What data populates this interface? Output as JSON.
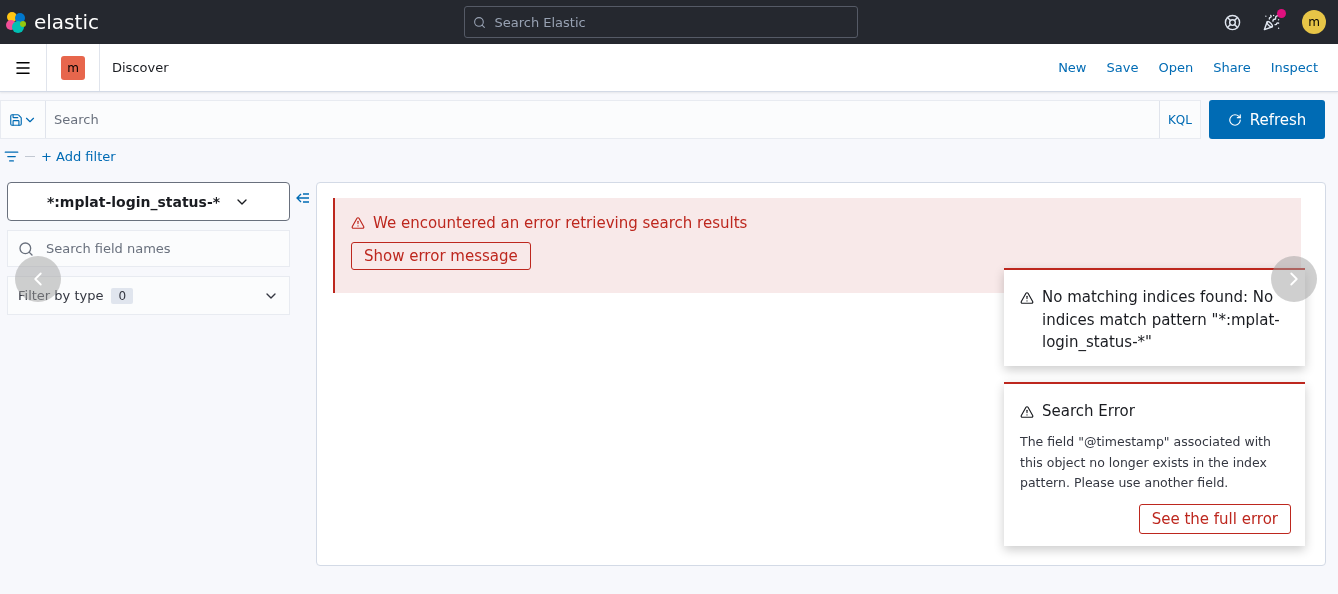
{
  "header": {
    "brand": "elastic",
    "search": {
      "placeholder": "Search Elastic"
    },
    "notification_badge": true,
    "avatar": "m"
  },
  "app_bar": {
    "space": "m",
    "title": "Discover",
    "actions": [
      "New",
      "Save",
      "Open",
      "Share",
      "Inspect"
    ]
  },
  "query_bar": {
    "placeholder": "Search",
    "language": "KQL",
    "refresh": "Refresh"
  },
  "filter_bar": {
    "add_filter": "+ Add filter"
  },
  "sidebar": {
    "index_pattern": "*:mplat-login_status-*",
    "field_search": {
      "placeholder": "Search field names"
    },
    "filter_by_type": {
      "label": "Filter by type",
      "count": "0"
    }
  },
  "callout": {
    "title": "We encountered an error retrieving search results",
    "button": "Show error message"
  },
  "toasts": [
    {
      "kind": "title_only",
      "title": "No matching indices found: No indices match pattern \"*:mplat-login_status-*\""
    },
    {
      "kind": "detail",
      "title": "Search Error",
      "body": "The field \"@timestamp\" associated with this object no longer exists in the index pattern. Please use another field.",
      "button": "See the full error"
    }
  ]
}
